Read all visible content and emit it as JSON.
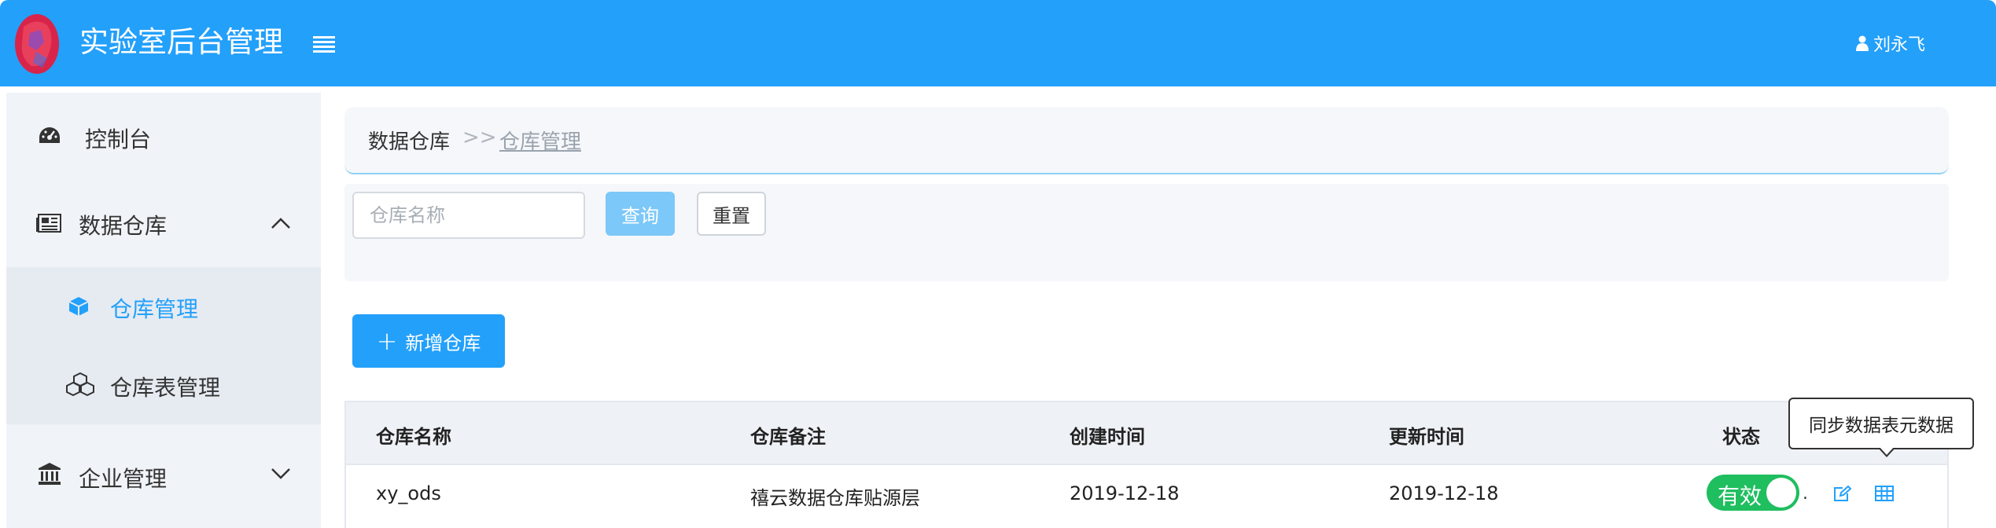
{
  "header": {
    "title": "实验室后台管理",
    "user_name": "刘永飞"
  },
  "sidebar": {
    "items": [
      {
        "label": "控制台",
        "icon": "dashboard-icon"
      },
      {
        "label": "数据仓库",
        "icon": "newspaper-icon",
        "expanded": true
      },
      {
        "label": "仓库管理",
        "icon": "cube-icon",
        "active": true
      },
      {
        "label": "仓库表管理",
        "icon": "cubes-icon"
      },
      {
        "label": "企业管理",
        "icon": "bank-icon",
        "expanded": false
      }
    ]
  },
  "breadcrumb": {
    "root": "数据仓库",
    "separator": ">>",
    "current": "仓库管理"
  },
  "filter": {
    "name_placeholder": "仓库名称",
    "query_label": "查询",
    "reset_label": "重置"
  },
  "actions": {
    "add_label": "新增仓库"
  },
  "table": {
    "columns": [
      "仓库名称",
      "仓库备注",
      "创建时间",
      "更新时间",
      "状态"
    ],
    "rows": [
      {
        "name": "xy_ods",
        "remark": "禧云数据仓库贴源层",
        "created": "2019-12-18",
        "updated": "2019-12-18",
        "status": "有效",
        "status_on": true
      }
    ]
  },
  "tooltip": {
    "text": "同步数据表元数据"
  },
  "colors": {
    "primary": "#23a0fa",
    "switch_on": "#1fbe5f",
    "sidebar_bg": "#f0f3f7"
  }
}
